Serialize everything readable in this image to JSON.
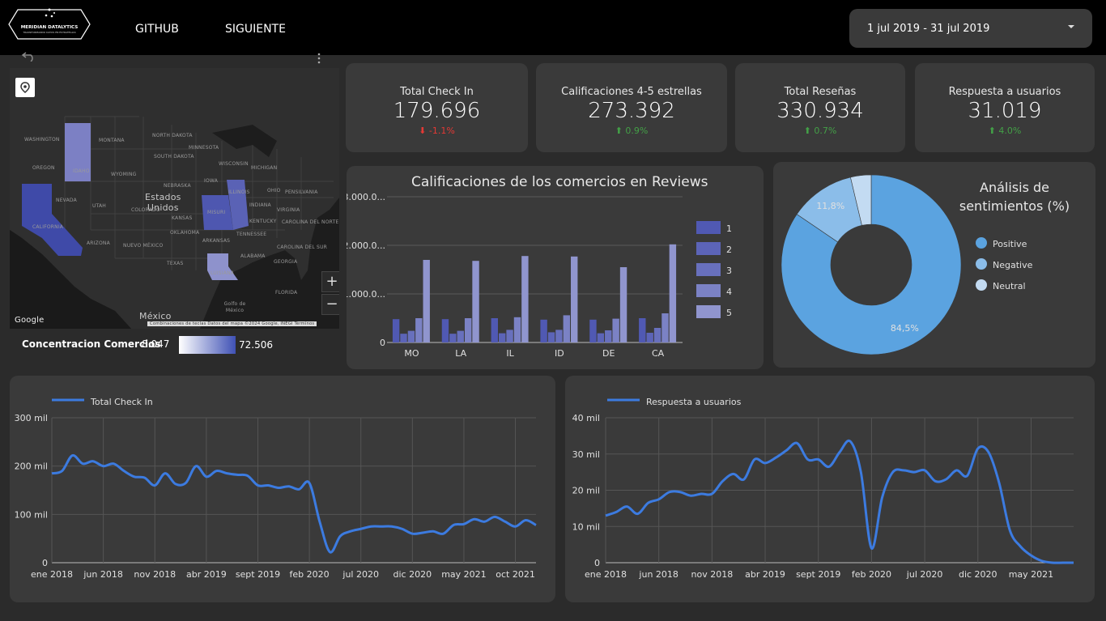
{
  "header": {
    "logo_name": "MERIDIAN DATALYTICS",
    "logo_tagline": "TRANSFORMANDO DATOS EN ESTRATEGIAS",
    "nav": [
      "GITHUB",
      "SIGUIENTE"
    ],
    "date_range": "1 jul 2019 - 31 jul 2019"
  },
  "kpis": [
    {
      "label": "Total Check In",
      "value": "179.696",
      "delta": "-1.1%",
      "direction": "down"
    },
    {
      "label": "Calificaciones 4-5 estrellas",
      "value": "273.392",
      "delta": "0.9%",
      "direction": "up"
    },
    {
      "label": "Total Reseñas",
      "value": "330.934",
      "delta": "0.7%",
      "direction": "up"
    },
    {
      "label": "Respuesta a usuarios",
      "value": "31.019",
      "delta": "4.0%",
      "direction": "up"
    }
  ],
  "map": {
    "country_label": "Estados\nUnidos",
    "mexico_label": "México",
    "gulf_label": "Golfo de México",
    "google_label": "Google",
    "attribution": "Combinaciones de teclas   Datos del mapa ©2024 Google, INEGI   Términos",
    "state_labels": [
      "WASHINGTON",
      "MONTANA",
      "NORTH DAKOTA",
      "MINNESOTA",
      "OREGON",
      "IDAHO",
      "SOUTH DAKOTA",
      "WISCONSIN",
      "MICHIGAN",
      "WYOMING",
      "IOWA",
      "NEBRASKA",
      "ILLINOIS",
      "OHIO",
      "PENSILVANIA",
      "NEVADA",
      "UTAH",
      "COLORADO",
      "KANSAS",
      "MISURI",
      "INDIANA",
      "VIRGINIA",
      "CALIFORNIA",
      "KENTUCKY",
      "TENNESSEE",
      "CAROLINA DEL NORTE",
      "OKLAHOMA",
      "ARKANSAS",
      "CAROLINA DEL SUR",
      "ARIZONA",
      "NUEVO MÉXICO",
      "GEORGIA",
      "ALABAMA",
      "TEXAS",
      "LUISIANA",
      "FLORIDA"
    ],
    "legend_title": "Concentracion Comercios",
    "legend_min": "8.047",
    "legend_max": "72.506",
    "highlight_colors": {
      "idaho": "#7c80c4",
      "california": "#3f4aa8",
      "misuri": "#4e57b0",
      "illinois": "#5a62b5",
      "luisiana": "#8e92cc"
    }
  },
  "bar_chart": {
    "chart_data": {
      "type": "bar",
      "title": "Calificaciones de los comercios en Reviews",
      "categories": [
        "MO",
        "LA",
        "IL",
        "ID",
        "DE",
        "CA"
      ],
      "y_ticks": [
        "3.000.0...",
        "2.000.0...",
        "1.000.0...",
        "0"
      ],
      "ylim": [
        0,
        3000000
      ],
      "series": [
        {
          "name": "1",
          "color": "#5059b3",
          "values": [
            480000,
            480000,
            500000,
            470000,
            470000,
            500000
          ]
        },
        {
          "name": "2",
          "color": "#5c64b8",
          "values": [
            180000,
            180000,
            190000,
            210000,
            190000,
            200000
          ]
        },
        {
          "name": "3",
          "color": "#6870bd",
          "values": [
            240000,
            240000,
            260000,
            260000,
            250000,
            300000
          ]
        },
        {
          "name": "4",
          "color": "#7b82c5",
          "values": [
            500000,
            500000,
            520000,
            560000,
            490000,
            600000
          ]
        },
        {
          "name": "5",
          "color": "#9095ce",
          "values": [
            1700000,
            1680000,
            1780000,
            1770000,
            1550000,
            2020000
          ]
        }
      ]
    }
  },
  "pie_chart": {
    "chart_data": {
      "type": "pie",
      "title": "Análisis de\nsentimientos (%)",
      "labels": [
        "Positive",
        "Negative",
        "Neutral"
      ],
      "values": [
        84.5,
        11.8,
        3.7
      ],
      "data_labels": [
        "84,5%",
        "11,8%",
        ""
      ],
      "colors": [
        "#5ba3e0",
        "#8bbde9",
        "#c3dbf2"
      ]
    }
  },
  "line_charts": [
    {
      "chart_data": {
        "type": "line",
        "title": "Total Check In",
        "y_ticks": [
          "300 mil",
          "200 mil",
          "100 mil",
          "0"
        ],
        "ylim": [
          0,
          300000
        ],
        "x_ticks": [
          "ene 2018",
          "jun 2018",
          "nov 2018",
          "abr 2019",
          "sept 2019",
          "feb 2020",
          "jul 2020",
          "dic 2020",
          "may 2021",
          "oct 2021"
        ],
        "color": "#3c7be0",
        "x": [
          "2018-01",
          "2018-02",
          "2018-03",
          "2018-04",
          "2018-05",
          "2018-06",
          "2018-07",
          "2018-08",
          "2018-09",
          "2018-10",
          "2018-11",
          "2018-12",
          "2019-01",
          "2019-02",
          "2019-03",
          "2019-04",
          "2019-05",
          "2019-06",
          "2019-07",
          "2019-08",
          "2019-09",
          "2019-10",
          "2019-11",
          "2019-12",
          "2020-01",
          "2020-02",
          "2020-03",
          "2020-04",
          "2020-05",
          "2020-06",
          "2020-07",
          "2020-08",
          "2020-09",
          "2020-10",
          "2020-11",
          "2020-12",
          "2021-01",
          "2021-02",
          "2021-03",
          "2021-04",
          "2021-05",
          "2021-06",
          "2021-07",
          "2021-08",
          "2021-09",
          "2021-10",
          "2021-11",
          "2021-12"
        ],
        "values": [
          185000,
          190000,
          222000,
          205000,
          210000,
          200000,
          205000,
          190000,
          178000,
          176000,
          160000,
          185000,
          163000,
          165000,
          200000,
          178000,
          190000,
          185000,
          182000,
          180000,
          160000,
          160000,
          155000,
          158000,
          152000,
          165000,
          85000,
          22000,
          55000,
          65000,
          70000,
          75000,
          75000,
          75000,
          70000,
          60000,
          62000,
          65000,
          60000,
          78000,
          80000,
          90000,
          85000,
          95000,
          85000,
          75000,
          88000,
          78000
        ]
      }
    },
    {
      "chart_data": {
        "type": "line",
        "title": "Respuesta a usuarios",
        "y_ticks": [
          "40 mil",
          "30 mil",
          "20 mil",
          "10 mil",
          "0"
        ],
        "ylim": [
          0,
          40000
        ],
        "x_ticks": [
          "ene 2018",
          "jun 2018",
          "nov 2018",
          "abr 2019",
          "sept 2019",
          "feb 2020",
          "jul 2020",
          "dic 2020",
          "may 2021"
        ],
        "color": "#3c7be0",
        "x": [
          "2018-01",
          "2018-02",
          "2018-03",
          "2018-04",
          "2018-05",
          "2018-06",
          "2018-07",
          "2018-08",
          "2018-09",
          "2018-10",
          "2018-11",
          "2018-12",
          "2019-01",
          "2019-02",
          "2019-03",
          "2019-04",
          "2019-05",
          "2019-06",
          "2019-07",
          "2019-08",
          "2019-09",
          "2019-10",
          "2019-11",
          "2019-12",
          "2020-01",
          "2020-02",
          "2020-03",
          "2020-04",
          "2020-05",
          "2020-06",
          "2020-07",
          "2020-08",
          "2020-09",
          "2020-10",
          "2020-11",
          "2020-12",
          "2021-01",
          "2021-02",
          "2021-03",
          "2021-04",
          "2021-05",
          "2021-06",
          "2021-07",
          "2021-08",
          "2021-09"
        ],
        "values": [
          13000,
          14000,
          15500,
          13500,
          16500,
          17500,
          19500,
          19500,
          18500,
          19000,
          19000,
          22500,
          24500,
          23000,
          28500,
          27500,
          29000,
          31000,
          33000,
          28500,
          28500,
          26500,
          30500,
          33500,
          25000,
          4000,
          18000,
          25000,
          25500,
          25000,
          25500,
          22500,
          23000,
          25500,
          24000,
          31500,
          30500,
          22000,
          9000,
          4500,
          2000,
          500,
          0,
          0,
          0
        ]
      }
    }
  ]
}
